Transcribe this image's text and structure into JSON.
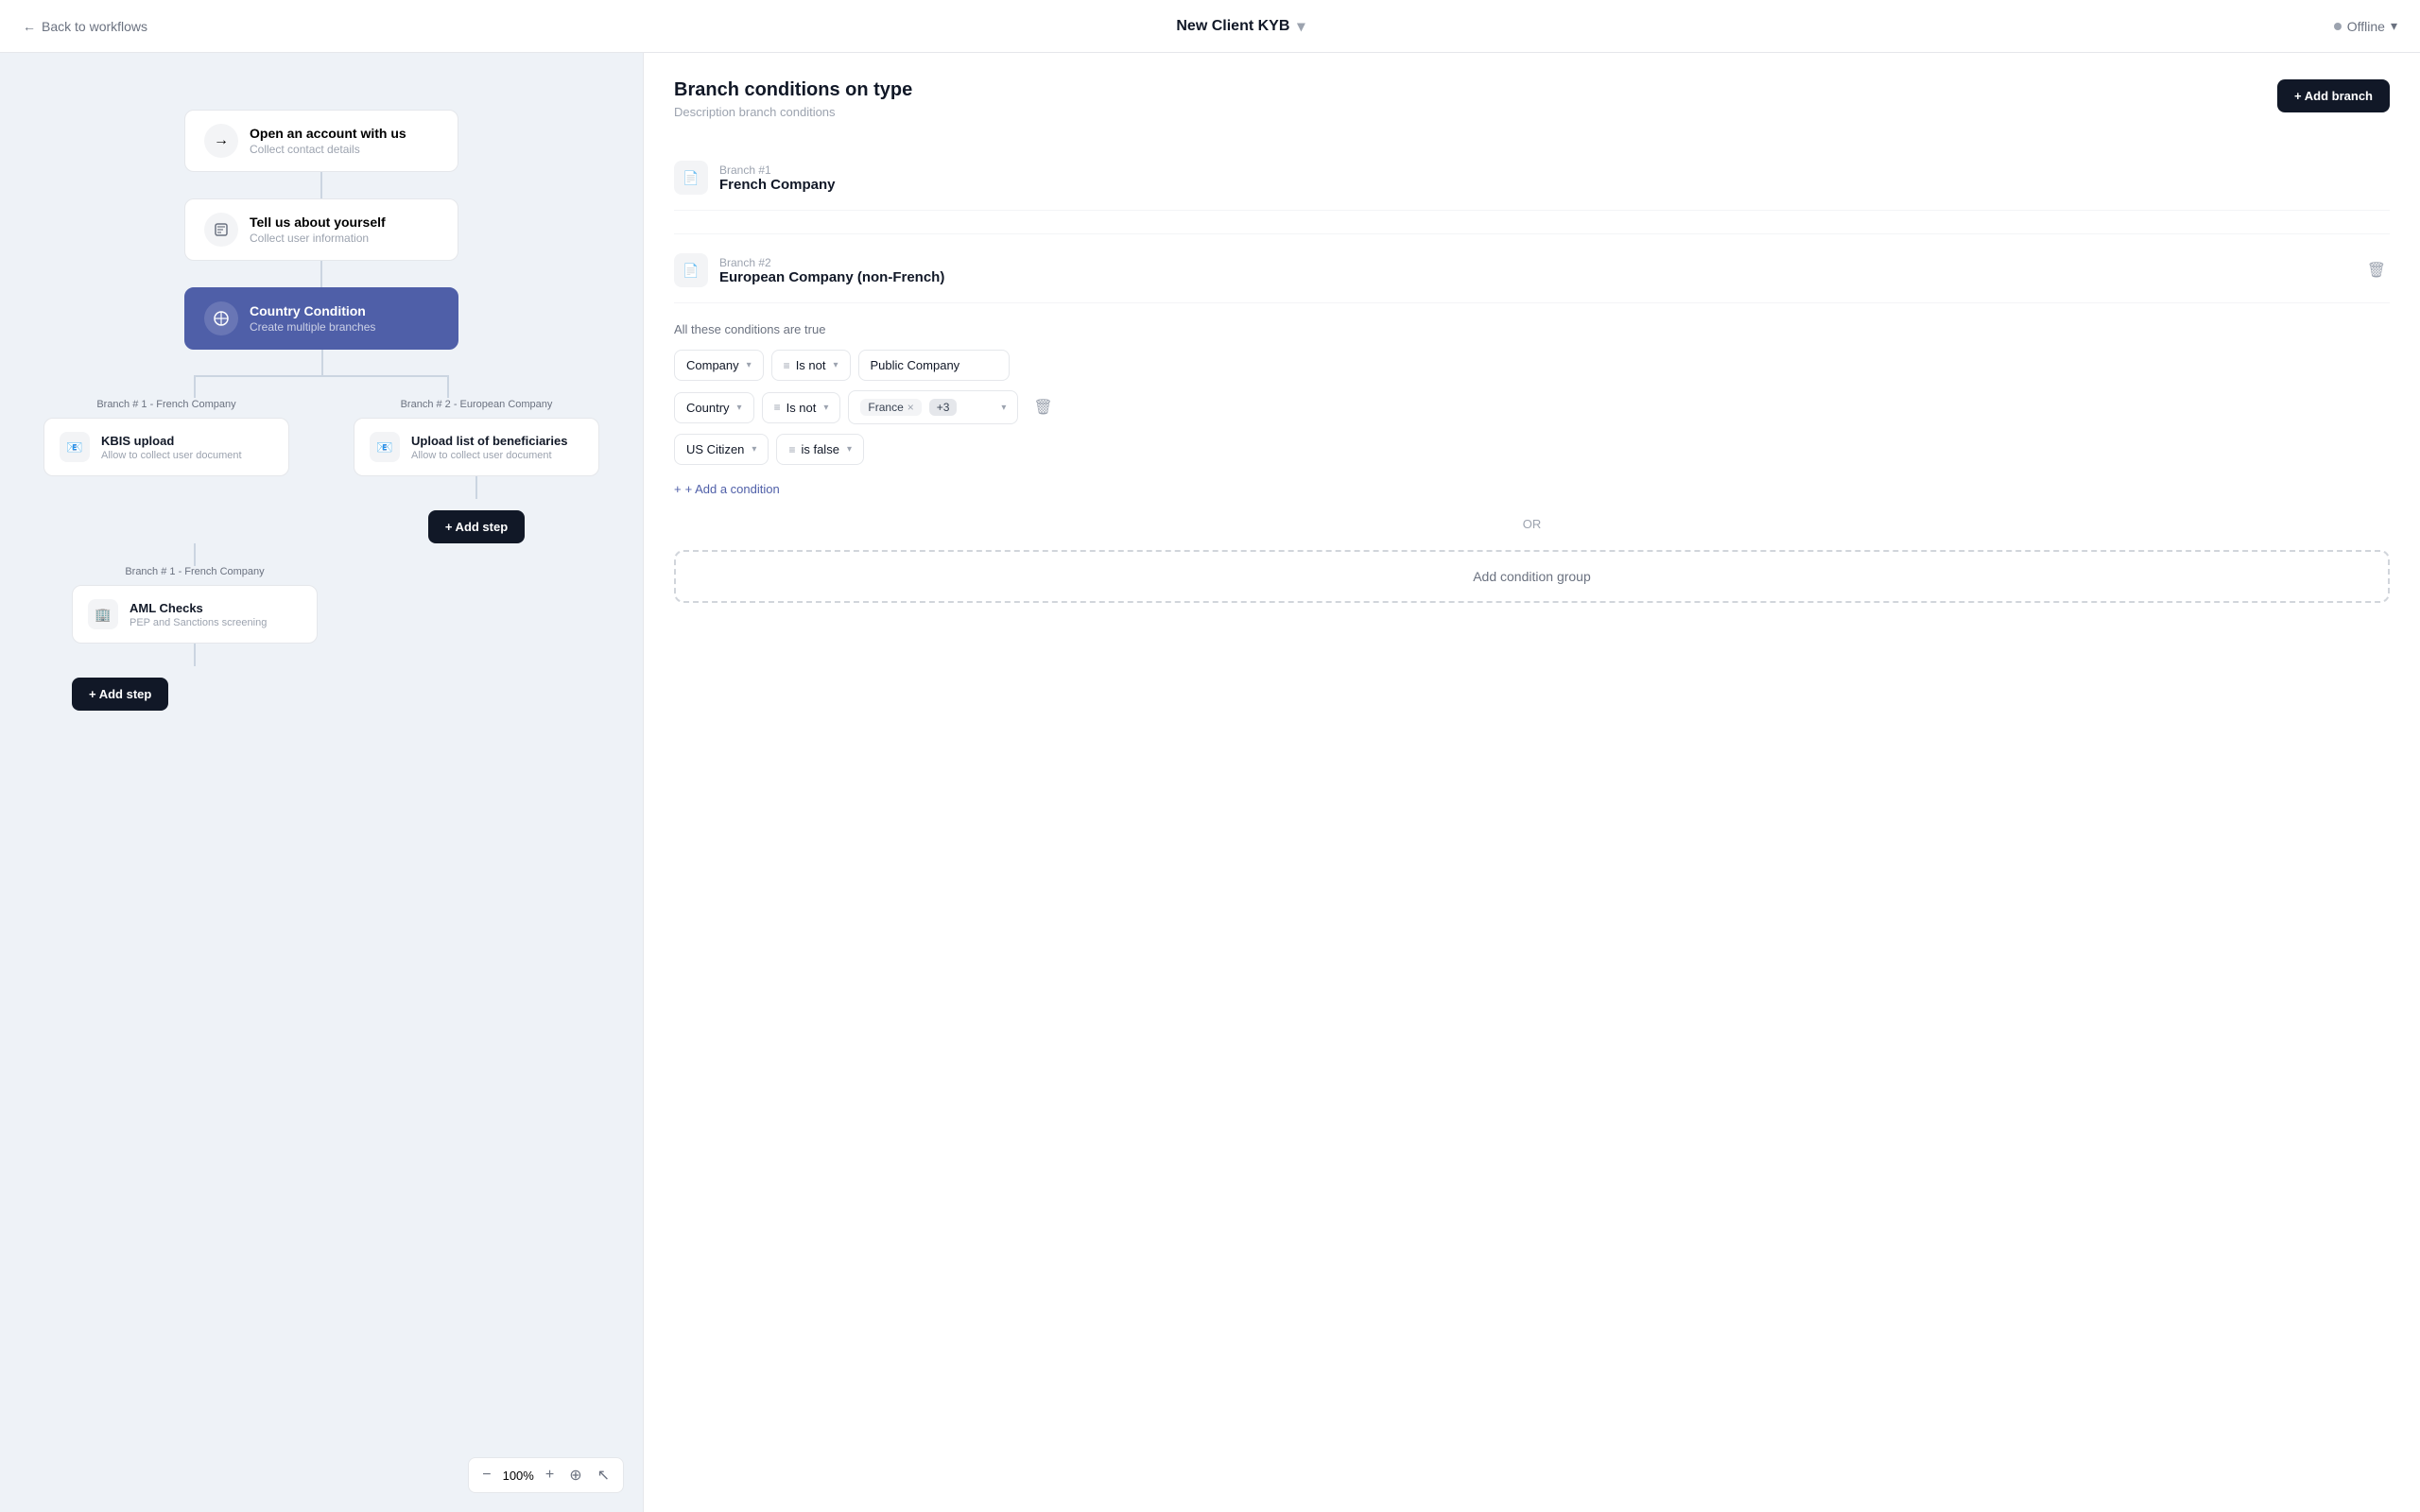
{
  "header": {
    "back_label": "Back to workflows",
    "title": "New Client KYB",
    "chevron": "▾",
    "status_label": "Offline",
    "status_chevron": "▾"
  },
  "canvas": {
    "zoom_label": "100%",
    "nodes": [
      {
        "id": "node-open-account",
        "title": "Open an account with us",
        "subtitle": "Collect contact details",
        "icon": "→",
        "active": false
      },
      {
        "id": "node-tell-yourself",
        "title": "Tell us about yourself",
        "subtitle": "Collect user information",
        "icon": "📋",
        "active": false
      },
      {
        "id": "node-country-condition",
        "title": "Country Condition",
        "subtitle": "Create multiple branches",
        "icon": "⊕",
        "active": true
      }
    ],
    "branches": [
      {
        "label": "Branch # 1 - French Company",
        "card_title": "KBIS upload",
        "card_subtitle": "Allow to collect user document",
        "icon": "📧"
      },
      {
        "label": "Branch # 2 - European Company",
        "card_title": "Upload list of beneficiaries",
        "card_subtitle": "Allow to collect user document",
        "icon": "📧"
      }
    ],
    "branch1_second": {
      "label": "Branch # 1 - French Company",
      "card_title": "AML Checks",
      "card_subtitle": "PEP and Sanctions screening",
      "icon": "🏢"
    },
    "add_step_label": "+ Add step",
    "add_step2_label": "+ Add step"
  },
  "right_panel": {
    "title": "Branch conditions on type",
    "subtitle": "Description branch conditions",
    "add_branch_label": "+ Add branch",
    "branch1": {
      "num": "Branch #1",
      "name": "French Company",
      "icon": "📄"
    },
    "branch2": {
      "num": "Branch #2",
      "name": "European Company (non-French)",
      "icon": "📄",
      "conditions_label": "All these conditions are true",
      "rows": [
        {
          "field": "Company",
          "operator": "Is not",
          "value": "Public Company",
          "has_tag": false,
          "deletable": false
        },
        {
          "field": "Country",
          "operator": "Is not",
          "tag": "France",
          "extra": "+3",
          "has_tag": true,
          "deletable": true
        },
        {
          "field": "US Citizen",
          "operator": "is false",
          "value": "",
          "has_tag": false,
          "deletable": false
        }
      ],
      "add_condition_label": "+ Add a condition",
      "or_label": "OR",
      "add_group_label": "Add condition group"
    }
  }
}
